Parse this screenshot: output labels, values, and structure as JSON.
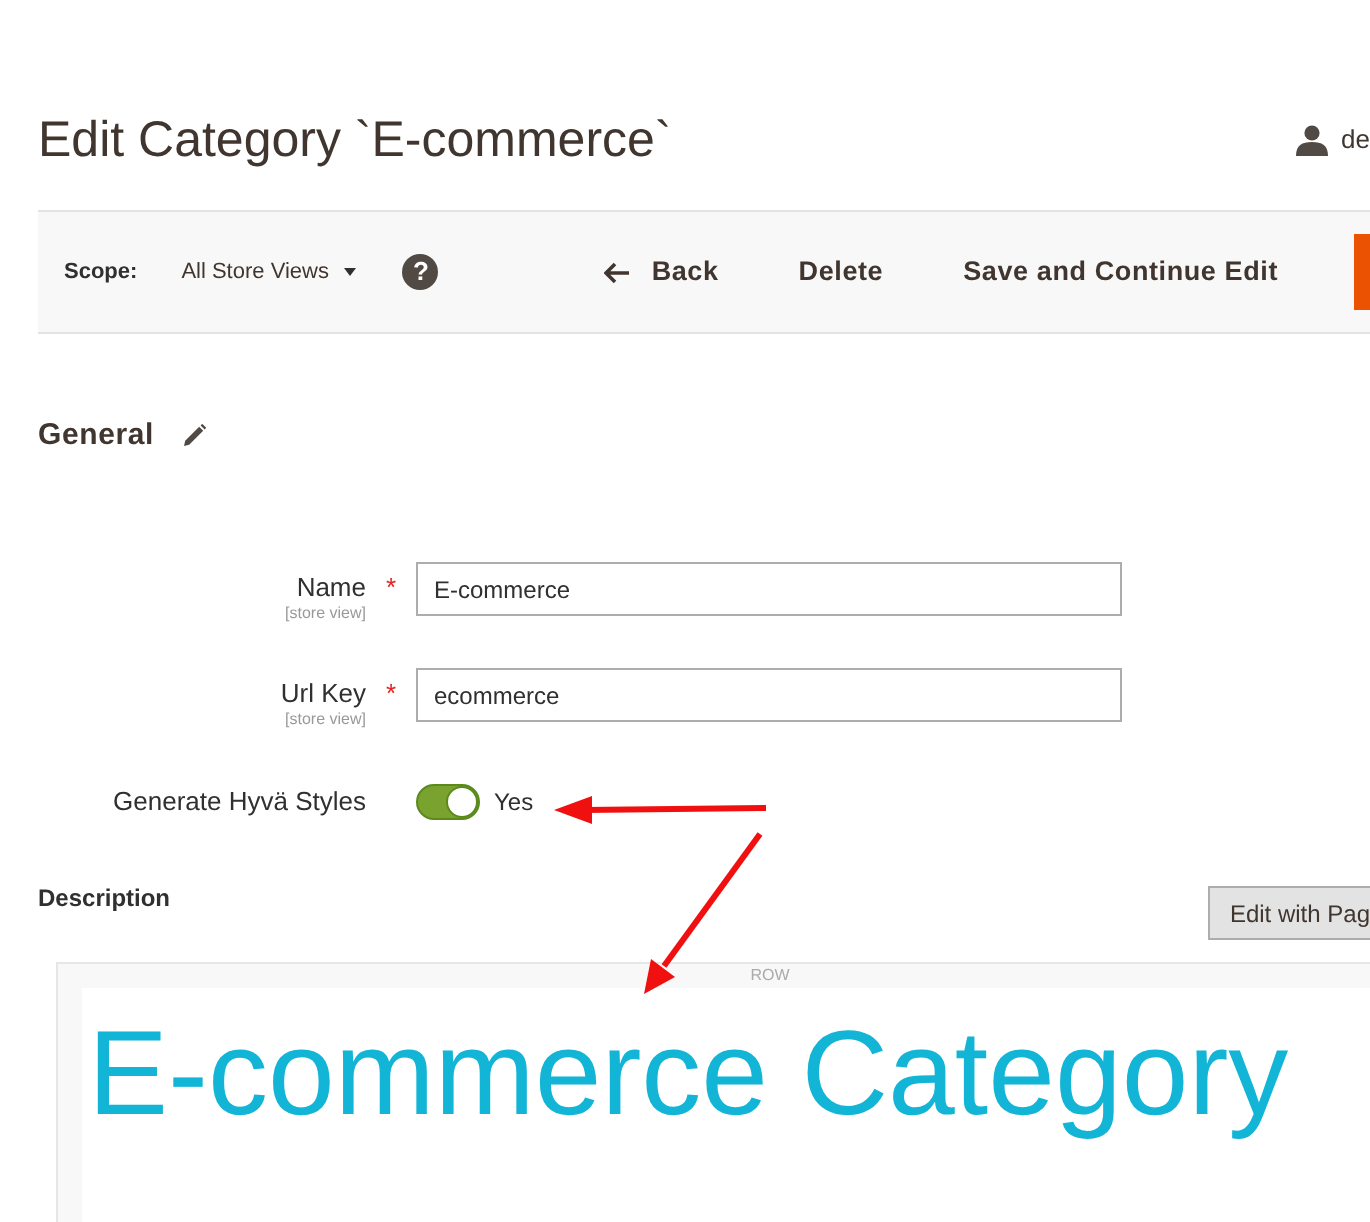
{
  "header": {
    "title": "Edit Category `E-commerce`",
    "user": "de"
  },
  "toolbar": {
    "scope_label": "Scope:",
    "scope_value": "All Store Views",
    "help": "?",
    "buttons": [
      {
        "kind": "back",
        "label": "Back"
      },
      {
        "kind": "plain",
        "label": "Delete"
      },
      {
        "kind": "plain",
        "label": "Save and Continue Edit"
      },
      {
        "kind": "primary"
      }
    ]
  },
  "section": {
    "title": "General"
  },
  "fields": [
    {
      "kind": "text",
      "label": "Name",
      "required_mark": "*",
      "scope": "[store view]",
      "value": "E-commerce"
    },
    {
      "kind": "text",
      "label": "Url Key",
      "required_mark": "*",
      "scope": "[store view]",
      "value": "ecommerce"
    },
    {
      "kind": "toggle",
      "label": "Generate Hyvä Styles",
      "on": true,
      "value": "Yes"
    }
  ],
  "description": {
    "label": "Description",
    "button": "Edit with Pag",
    "row_label": "ROW",
    "heading": "E-commerce Category"
  }
}
